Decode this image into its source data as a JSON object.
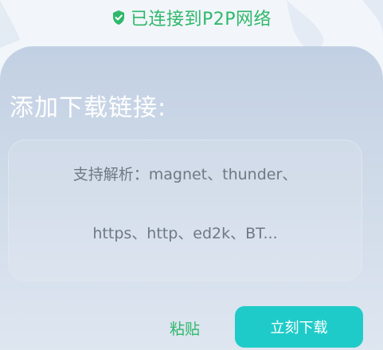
{
  "status": {
    "icon": "shield-check-icon",
    "text": "已连接到P2P网络",
    "color": "#2fb86b"
  },
  "panel": {
    "title": "添加下载链接:",
    "input": {
      "value": "",
      "placeholder_lines": [
        "支持解析：magnet、thunder、",
        "https、http、ed2k、BT..."
      ]
    }
  },
  "actions": {
    "paste_label": "粘贴",
    "download_label": "立刻下载",
    "accent_color": "#1fcbc9"
  }
}
